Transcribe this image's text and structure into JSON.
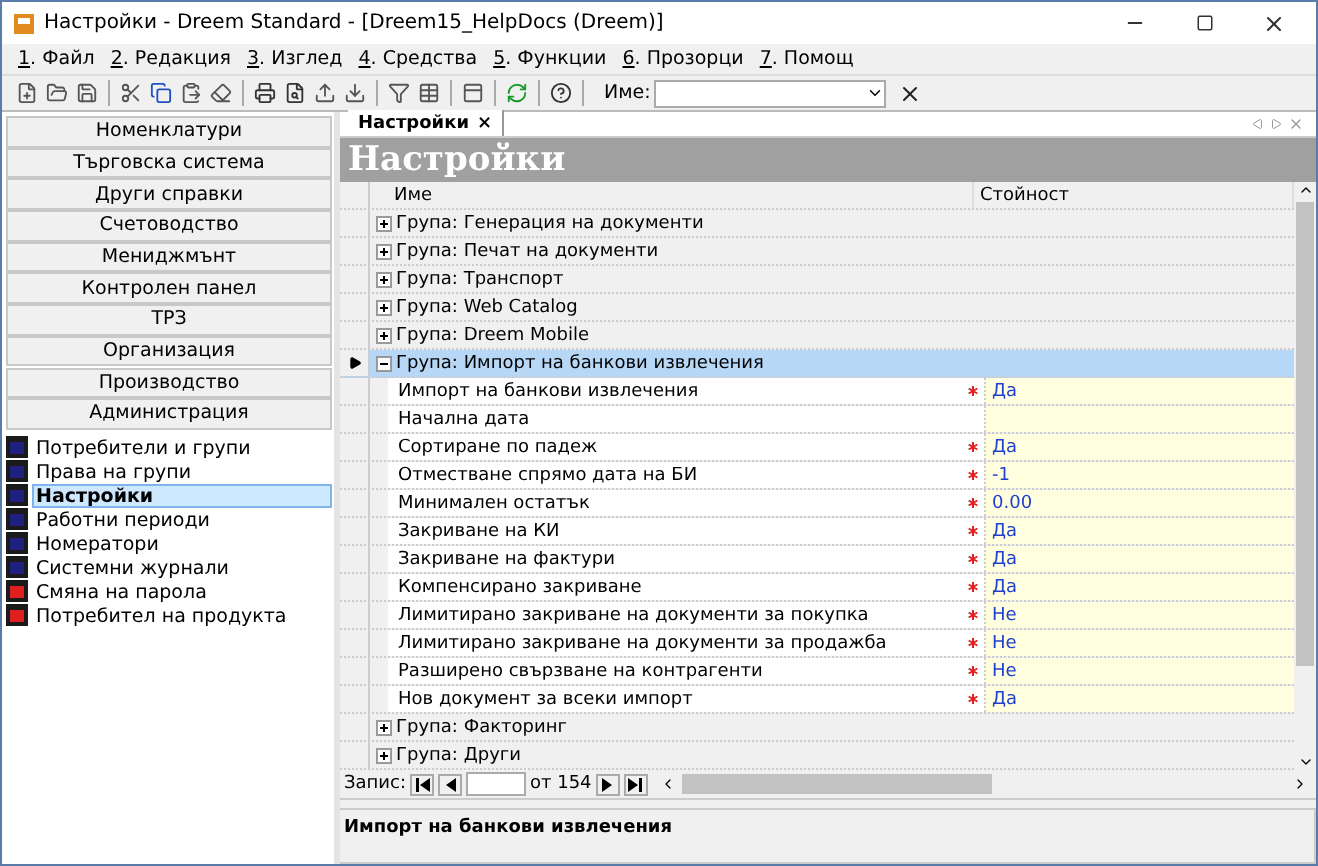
{
  "window": {
    "title": "Настройки - Dreem Standard - [Dreem15_HelpDocs (Dreem)]"
  },
  "menu": [
    "1. Файл",
    "2. Редакция",
    "3. Изглед",
    "4. Средства",
    "5. Функции",
    "6. Прозорци",
    "7. Помощ"
  ],
  "toolbar": {
    "name_label": "Име:"
  },
  "sidebar": {
    "sections": [
      "Номенклатури",
      "Търговска система",
      "Други справки",
      "Счетоводство",
      "Мениджмънт",
      "Контролен панел",
      "ТРЗ",
      "Организация",
      "Производство",
      "Администрация"
    ],
    "items": [
      {
        "label": "Потребители и групи",
        "selected": false,
        "kind": "group"
      },
      {
        "label": "Права на групи",
        "selected": false,
        "kind": "group"
      },
      {
        "label": "Настройки",
        "selected": true,
        "kind": "group"
      },
      {
        "label": "Работни периоди",
        "selected": false,
        "kind": "group"
      },
      {
        "label": "Номератори",
        "selected": false,
        "kind": "group"
      },
      {
        "label": "Системни журнали",
        "selected": false,
        "kind": "group"
      },
      {
        "label": "Смяна на парола",
        "selected": false,
        "kind": "key"
      },
      {
        "label": "Потребител на продукта",
        "selected": false,
        "kind": "key"
      }
    ]
  },
  "tab": {
    "label": "Настройки",
    "close": "×"
  },
  "page_title": "Настройки",
  "table": {
    "columns": [
      "Име",
      "Стойност"
    ],
    "rows": [
      {
        "kind": "group",
        "name": "Група: Генерация на документи",
        "expanded": false,
        "selected": false
      },
      {
        "kind": "group",
        "name": "Група: Печат на документи",
        "expanded": false,
        "selected": false
      },
      {
        "kind": "group",
        "name": "Група: Транспорт",
        "expanded": false,
        "selected": false
      },
      {
        "kind": "group",
        "name": "Група: Web Catalog",
        "expanded": false,
        "selected": false
      },
      {
        "kind": "group",
        "name": "Група: Dreem Mobile",
        "expanded": false,
        "selected": false
      },
      {
        "kind": "group",
        "name": "Група: Импорт на банкови извлечения",
        "expanded": true,
        "selected": true
      },
      {
        "kind": "setting",
        "name": "Импорт на банкови извлечения",
        "required": true,
        "value": "Да"
      },
      {
        "kind": "setting",
        "name": "Начална дата",
        "required": false
      },
      {
        "kind": "setting",
        "name": "Сортиране по падеж",
        "required": true,
        "value": "Да"
      },
      {
        "kind": "setting",
        "name": "Отместване спрямо дата на БИ",
        "required": true,
        "value": "-1"
      },
      {
        "kind": "setting",
        "name": "Минимален остатък",
        "required": true,
        "value": "0.00"
      },
      {
        "kind": "setting",
        "name": "Закриване на КИ",
        "required": true,
        "value": "Да"
      },
      {
        "kind": "setting",
        "name": "Закриване на фактури",
        "required": true,
        "value": "Да"
      },
      {
        "kind": "setting",
        "name": "Компенсирано закриване",
        "required": true,
        "value": "Да"
      },
      {
        "kind": "setting",
        "name": "Лимитирано закриване на документи за покупка",
        "required": true,
        "value": "Не"
      },
      {
        "kind": "setting",
        "name": "Лимитирано закриване на документи за продажба",
        "required": true,
        "value": "Не"
      },
      {
        "kind": "setting",
        "name": "Разширено свързване на контрагенти",
        "required": true,
        "value": "Не"
      },
      {
        "kind": "setting",
        "name": "Нов документ за всеки импорт",
        "required": true,
        "value": "Да"
      },
      {
        "kind": "group",
        "name": "Група: Факторинг",
        "expanded": false,
        "selected": false
      },
      {
        "kind": "group",
        "name": "Група: Други",
        "expanded": false,
        "selected": false
      }
    ]
  },
  "pager": {
    "label": "Запис:",
    "total": "от 154"
  },
  "description": "Импорт на банкови извлечения"
}
